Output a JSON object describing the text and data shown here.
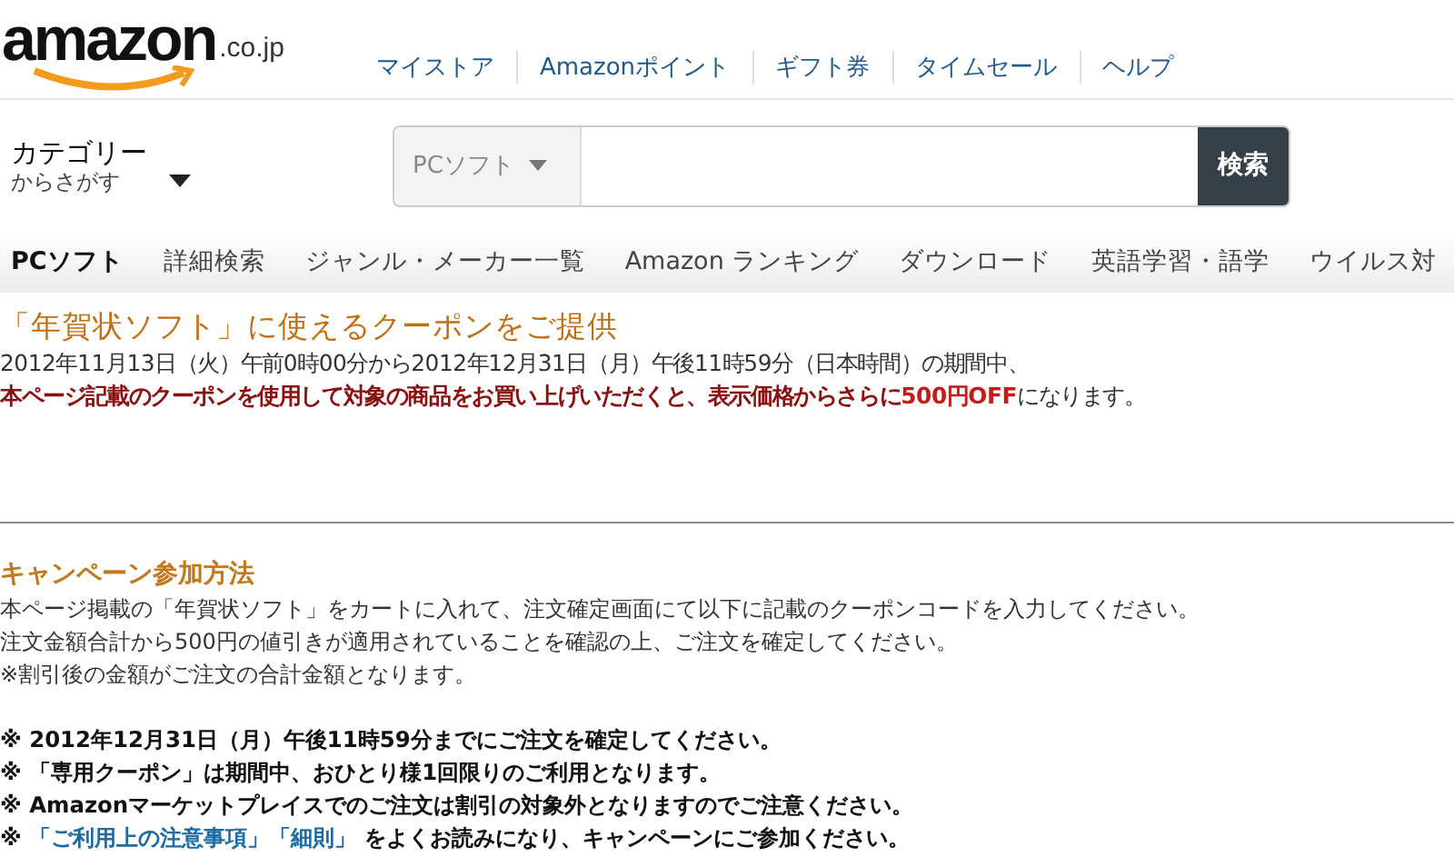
{
  "header": {
    "logo": {
      "word": "amazon",
      "suffix": ".co.jp"
    },
    "top_links": [
      "マイストア",
      "Amazonポイント",
      "ギフト券",
      "タイムセール",
      "ヘルプ"
    ],
    "category": {
      "title": "カテゴリー",
      "subtitle": "からさがす"
    },
    "search": {
      "scope": "PCソフト",
      "button": "検索"
    },
    "nav": [
      {
        "label": "PCソフト",
        "selected": true
      },
      {
        "label": "詳細検索",
        "selected": false
      },
      {
        "label": "ジャンル・メーカー一覧",
        "selected": false
      },
      {
        "label": "Amazon ランキング",
        "selected": false
      },
      {
        "label": "ダウンロード",
        "selected": false
      },
      {
        "label": "英語学習・語学",
        "selected": false
      },
      {
        "label": "ウイルス対",
        "selected": false
      }
    ]
  },
  "promo": {
    "title": "「年賀状ソフト」に使えるクーポンをご提供",
    "lines": [
      [
        {
          "text": "2012年11月13日（火）午前0時00分から2012年12月31日（月）午後11時59分（日本時間）の期間中、",
          "kind": "plain"
        }
      ],
      [
        {
          "text": "本ページ記載のクーポンを使用して対象の商品をお買い上げいただくと、表示価格からさらに",
          "kind": "emphasis"
        },
        {
          "text": "500円OFF",
          "kind": "price"
        },
        {
          "text": "になります。",
          "kind": "plain"
        }
      ]
    ]
  },
  "campaign": {
    "heading": "キャンペーン参加方法",
    "body": [
      "本ページ掲載の「年賀状ソフト」をカートに入れて、注文確定画面にて以下に記載のクーポンコードを入力してください。",
      "注文金額合計から500円の値引きが適用されていることを確認の上、ご注文を確定してください。",
      "※割引後の金額がご注文の合計金額となります。"
    ],
    "notes": [
      [
        {
          "text": "※ 2012年12月31日（月）午後11時59分までにご注文を確定してください。",
          "kind": "plain"
        }
      ],
      [
        {
          "text": "※ 「専用クーポン」は期間中、おひとり様1回限りのご利用となります。",
          "kind": "plain"
        }
      ],
      [
        {
          "text": "※ Amazonマーケットプレイスでのご注文は割引の対象外となりますのでご注意ください。",
          "kind": "plain"
        }
      ],
      [
        {
          "text": "※ ",
          "kind": "plain"
        },
        {
          "text": "「ご利用上の注意事項」",
          "kind": "link"
        },
        {
          "text": "「細則」",
          "kind": "link"
        },
        {
          "text": " をよくお読みになり、キャンペーンにご参加ください。",
          "kind": "plain"
        }
      ]
    ]
  }
}
